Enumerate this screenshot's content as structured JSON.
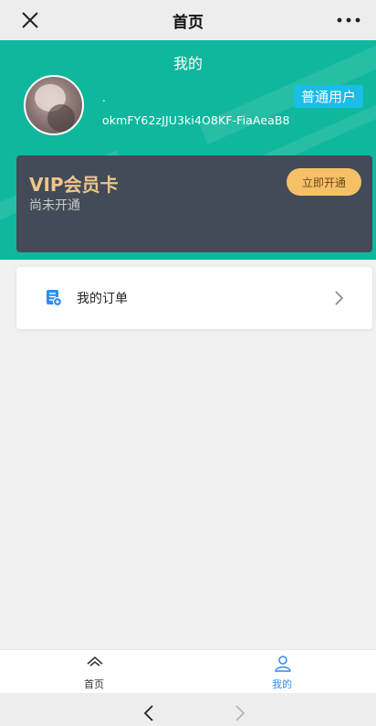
{
  "topbar": {
    "title": "首页"
  },
  "hero": {
    "page_title": "我的",
    "nickname": ".",
    "user_id": "okmFY62zJJU3ki4O8KF-FiaAeaB8",
    "badge": "普通用户"
  },
  "vip_card": {
    "title": "VIP会员卡",
    "status": "尚未开通",
    "button": "立即开通"
  },
  "menu": {
    "orders_label": "我的订单"
  },
  "tabbar": {
    "home_label": "首页",
    "mine_label": "我的"
  },
  "colors": {
    "header_green": "#0fb79c",
    "badge_blue": "#19bde6",
    "vip_gold": "#f0c48a",
    "vip_button": "#f6c067",
    "tab_active": "#2f8cf0"
  },
  "icons": [
    "close-icon",
    "more-icon",
    "order-doc-icon",
    "chevron-right-icon",
    "home-icon",
    "user-icon",
    "back-icon",
    "forward-icon"
  ]
}
